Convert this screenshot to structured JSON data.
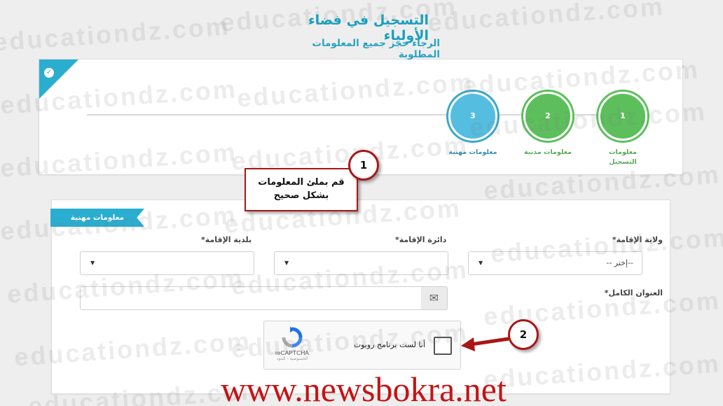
{
  "header": {
    "title": "التسجيل في فضاء الأولياء",
    "subtitle": "الرجاء حجز جميع المعلومات المطلوبة"
  },
  "wizard": {
    "steps": [
      {
        "number": "1",
        "label": "معلومات التسجيل",
        "state": "completed",
        "color": "#5cbf5c"
      },
      {
        "number": "2",
        "label": "معلومات مدنية",
        "state": "completed",
        "color": "#5cbf5c"
      },
      {
        "number": "3",
        "label": "معلومات مهنية",
        "state": "active",
        "color": "#55bde0"
      }
    ],
    "corner_icon": "check-icon"
  },
  "form": {
    "section_title": "معلومات مهنية",
    "wilaya": {
      "label": "ولاية الإقامة*",
      "value": "--إختر --"
    },
    "daira": {
      "label": "دائرة الإقامة*",
      "value": ""
    },
    "baladia": {
      "label": "بلدية الإقامة*",
      "value": ""
    },
    "address": {
      "label": "العنوان الكامل*",
      "value": "",
      "icon": "envelope-icon"
    },
    "captcha": {
      "text": "أنا لست برنامج روبوت",
      "brand": "reCAPTCHA",
      "terms": "الخصوصية - البنود",
      "checked": false
    }
  },
  "annotations": {
    "callout_line1": "قم بملئ المعلومات",
    "callout_line2": "بشكل صحيح",
    "badge_1": "1",
    "badge_2": "2",
    "accent_color": "#a91616"
  },
  "watermark": {
    "text": "educationdz.com",
    "url": "www.newsbokra.net"
  }
}
